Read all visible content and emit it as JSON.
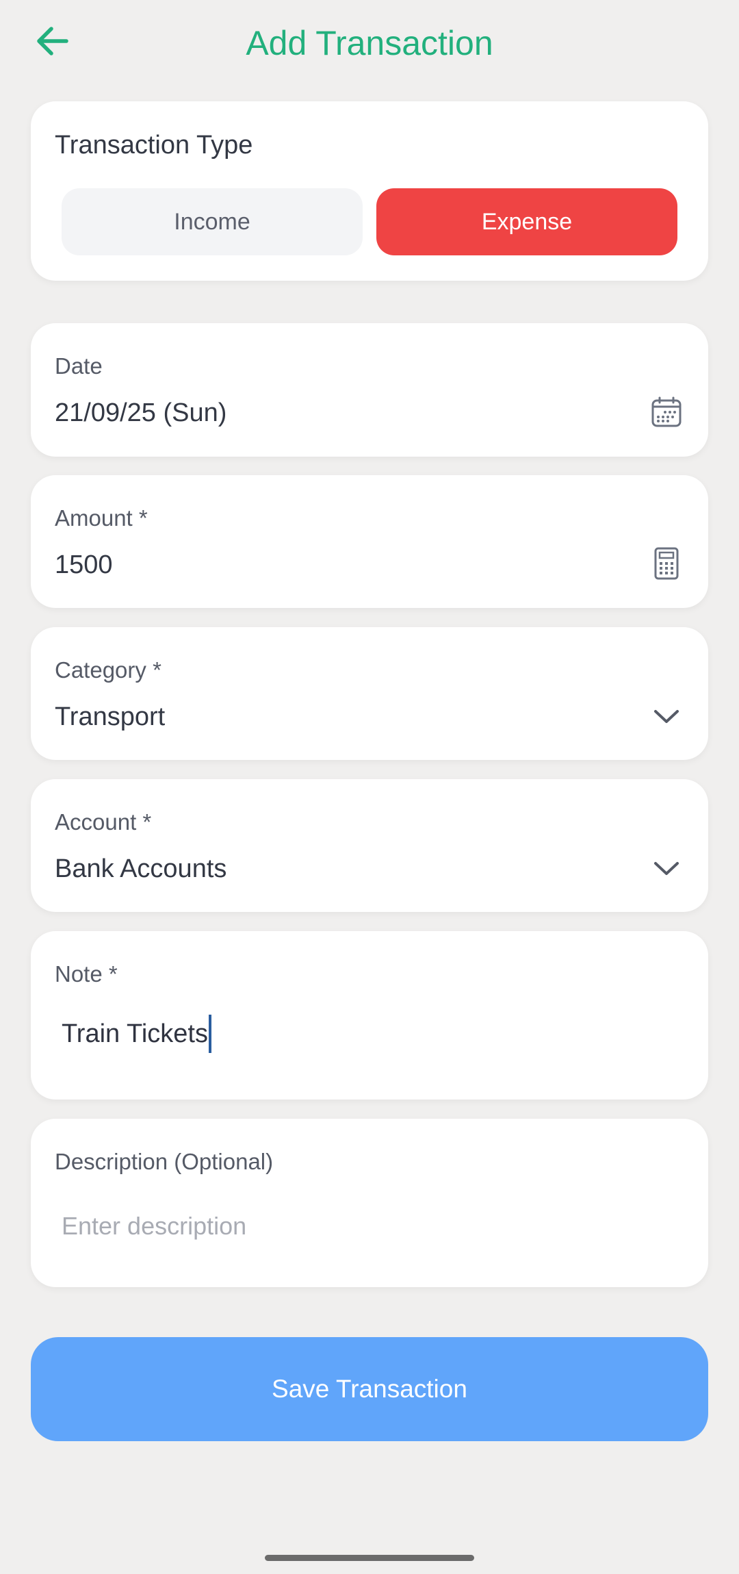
{
  "header": {
    "title": "Add Transaction",
    "back_icon": "arrow-left-icon",
    "accent_color": "#22b07d"
  },
  "transaction_type": {
    "title": "Transaction Type",
    "options": [
      "Income",
      "Expense"
    ],
    "selected": "Expense",
    "selected_color": "#ef4444"
  },
  "date": {
    "label": "Date",
    "value": "21/09/25 (Sun)",
    "icon": "calendar-icon"
  },
  "amount": {
    "label": "Amount *",
    "value": "1500",
    "icon": "calculator-icon"
  },
  "category": {
    "label": "Category *",
    "value": "Transport",
    "icon": "chevron-down-icon"
  },
  "account": {
    "label": "Account *",
    "value": "Bank Accounts",
    "icon": "chevron-down-icon"
  },
  "note": {
    "label": "Note *",
    "value": "Train Tickets"
  },
  "description": {
    "label": "Description (Optional)",
    "placeholder": "Enter description"
  },
  "save_button": {
    "label": "Save Transaction",
    "color": "#60a5fa"
  }
}
